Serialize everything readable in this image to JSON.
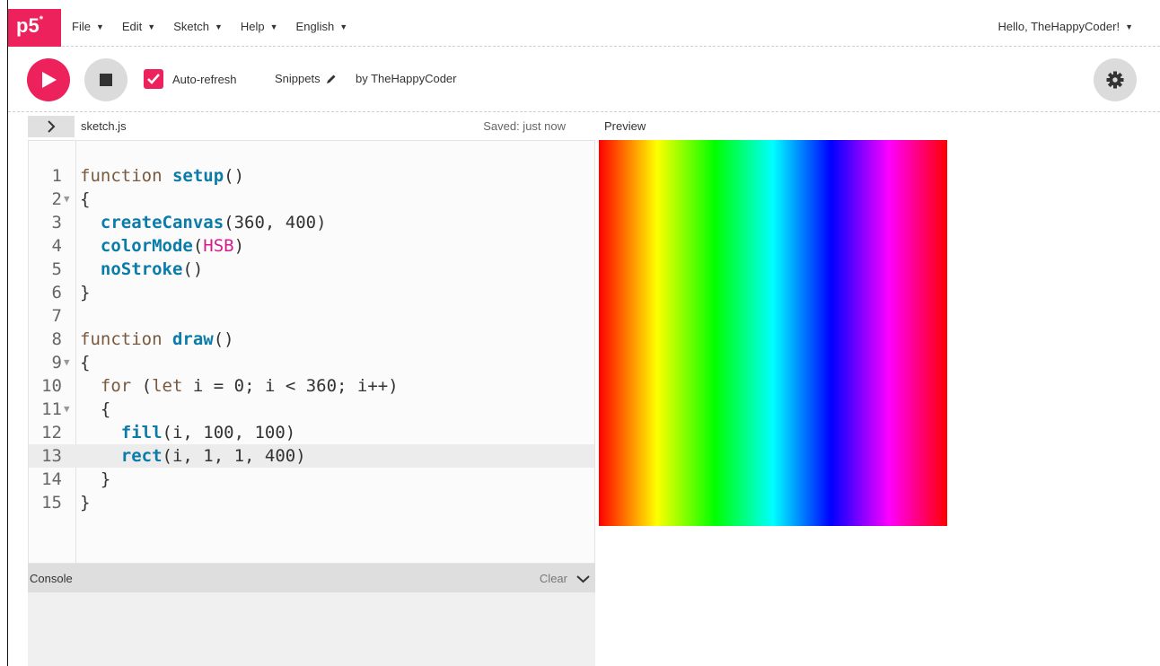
{
  "nav": {
    "logo": "p5",
    "logo_sup": "*",
    "menu": [
      {
        "label": "File"
      },
      {
        "label": "Edit"
      },
      {
        "label": "Sketch"
      },
      {
        "label": "Help"
      },
      {
        "label": "English"
      }
    ],
    "user_greeting": "Hello, TheHappyCoder!"
  },
  "toolbar": {
    "auto_refresh_label": "Auto-refresh",
    "auto_refresh_checked": true,
    "sketch_name": "Snippets",
    "by_author": "by TheHappyCoder"
  },
  "editor": {
    "file_name": "sketch.js",
    "saved_status": "Saved: just now",
    "active_line": 13,
    "lines": [
      "function setup()",
      "{",
      "  createCanvas(360, 400)",
      "  colorMode(HSB)",
      "  noStroke()",
      "}",
      "",
      "function draw()",
      "{",
      "  for (let i = 0; i < 360; i++)",
      "  {",
      "    fill(i, 100, 100)",
      "    rect(i, 1, 1, 400)",
      "  }",
      "}"
    ],
    "fold_lines": [
      2,
      9,
      11
    ]
  },
  "preview": {
    "label": "Preview"
  },
  "console": {
    "title": "Console",
    "clear_label": "Clear"
  },
  "colors": {
    "accent": "#ed225d",
    "keyword": "#7a5a3f",
    "function": "#0b7ca9",
    "atom": "#d51c8e"
  }
}
